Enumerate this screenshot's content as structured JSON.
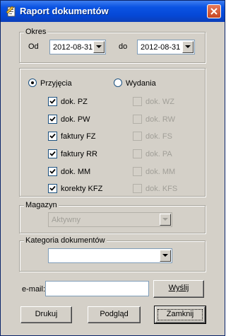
{
  "window": {
    "title": "Raport dokumentów"
  },
  "period": {
    "legend": "Okres",
    "from_label": "Od",
    "from_value": "2012-08-31",
    "to_label": "do",
    "to_value": "2012-08-31"
  },
  "type_group": {
    "receipts_label": "Przyjęcia",
    "issues_label": "Wydania",
    "selected": "Przyjęcia",
    "receipts": [
      {
        "label": "dok. PZ",
        "checked": true
      },
      {
        "label": "dok. PW",
        "checked": true
      },
      {
        "label": "faktury FZ",
        "checked": true
      },
      {
        "label": "faktury RR",
        "checked": true
      },
      {
        "label": "dok. MM",
        "checked": true
      },
      {
        "label": "korekty KFZ",
        "checked": true
      }
    ],
    "issues": [
      {
        "label": "dok. WZ",
        "checked": false
      },
      {
        "label": "dok. RW",
        "checked": false
      },
      {
        "label": "dok. FS",
        "checked": false
      },
      {
        "label": "dok. PA",
        "checked": false
      },
      {
        "label": "dok. MM",
        "checked": false
      },
      {
        "label": "dok. KFS",
        "checked": false
      }
    ]
  },
  "warehouse": {
    "legend": "Magazyn",
    "value": "Aktywny"
  },
  "category": {
    "legend": "Kategoria dokumentów",
    "value": ""
  },
  "email": {
    "label": "e-mail:",
    "value": "",
    "send_label": "Wyślij"
  },
  "footer": {
    "print_label": "Drukuj",
    "preview_label": "Podgląd",
    "close_label": "Zamknij"
  }
}
